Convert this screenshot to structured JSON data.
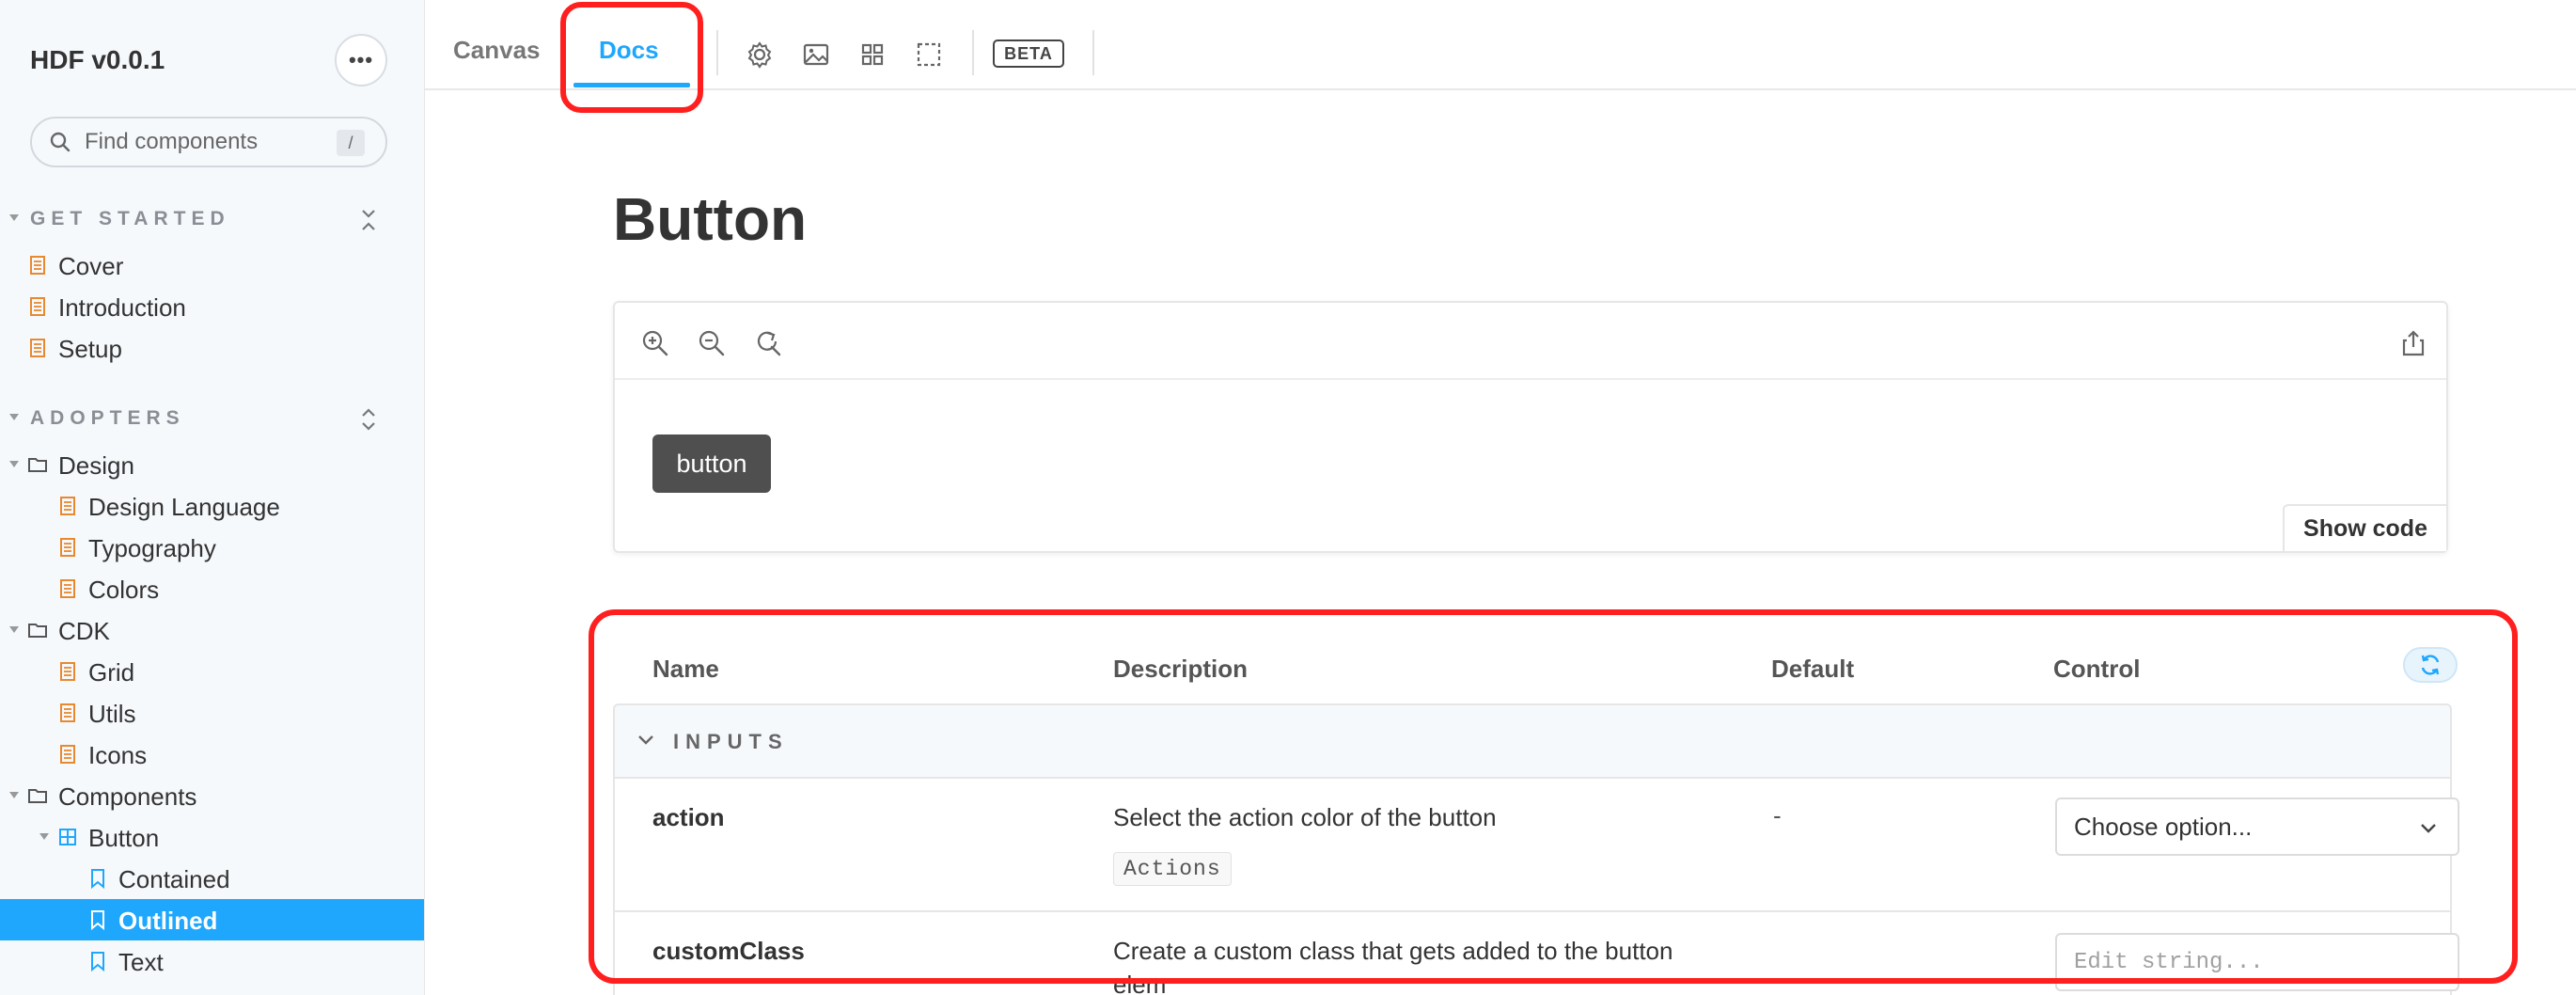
{
  "app": {
    "title": "HDF v0.0.1",
    "menu_label": "•••"
  },
  "search": {
    "placeholder": "Find components",
    "shortcut": "/"
  },
  "sidebar": {
    "sections": [
      {
        "title": "GET STARTED"
      },
      {
        "title": "ADOPTERS"
      }
    ],
    "items": [
      {
        "label": "Cover",
        "kind": "doc"
      },
      {
        "label": "Introduction",
        "kind": "doc"
      },
      {
        "label": "Setup",
        "kind": "doc"
      },
      {
        "label": "Design",
        "kind": "folder"
      },
      {
        "label": "Design Language",
        "kind": "doc"
      },
      {
        "label": "Typography",
        "kind": "doc"
      },
      {
        "label": "Colors",
        "kind": "doc"
      },
      {
        "label": "CDK",
        "kind": "folder"
      },
      {
        "label": "Grid",
        "kind": "doc"
      },
      {
        "label": "Utils",
        "kind": "doc"
      },
      {
        "label": "Icons",
        "kind": "doc"
      },
      {
        "label": "Components",
        "kind": "folder"
      },
      {
        "label": "Button",
        "kind": "component"
      },
      {
        "label": "Contained",
        "kind": "story"
      },
      {
        "label": "Outlined",
        "kind": "story",
        "selected": true
      },
      {
        "label": "Text",
        "kind": "story"
      }
    ]
  },
  "toolbar": {
    "tabs": [
      {
        "label": "Canvas"
      },
      {
        "label": "Docs",
        "active": true
      }
    ],
    "icons": [
      "settings-icon",
      "image-icon",
      "grid-icon",
      "outline-icon"
    ],
    "beta_label": "BETA"
  },
  "docs": {
    "title": "Button",
    "preview": {
      "zoom_icons": [
        "zoom-in-icon",
        "zoom-out-icon",
        "reset-zoom-icon"
      ],
      "demo_button_label": "button",
      "show_code_label": "Show code"
    },
    "argtable": {
      "columns": {
        "name": "Name",
        "description": "Description",
        "default": "Default",
        "control": "Control"
      },
      "group": "INPUTS",
      "rows": [
        {
          "name": "action",
          "description": "Select the action color of the button",
          "type": "Actions",
          "default": "-",
          "control_value": "Choose option..."
        },
        {
          "name": "customClass",
          "description": "Create a custom class that gets added to the button",
          "description_cont": "elem",
          "control_placeholder": "Edit string..."
        }
      ]
    }
  },
  "colors": {
    "accent": "#1ea7fd",
    "annotation": "#ff1f1f",
    "demo_button": "#4f4f4f",
    "doc_icon": "#e8892f"
  }
}
